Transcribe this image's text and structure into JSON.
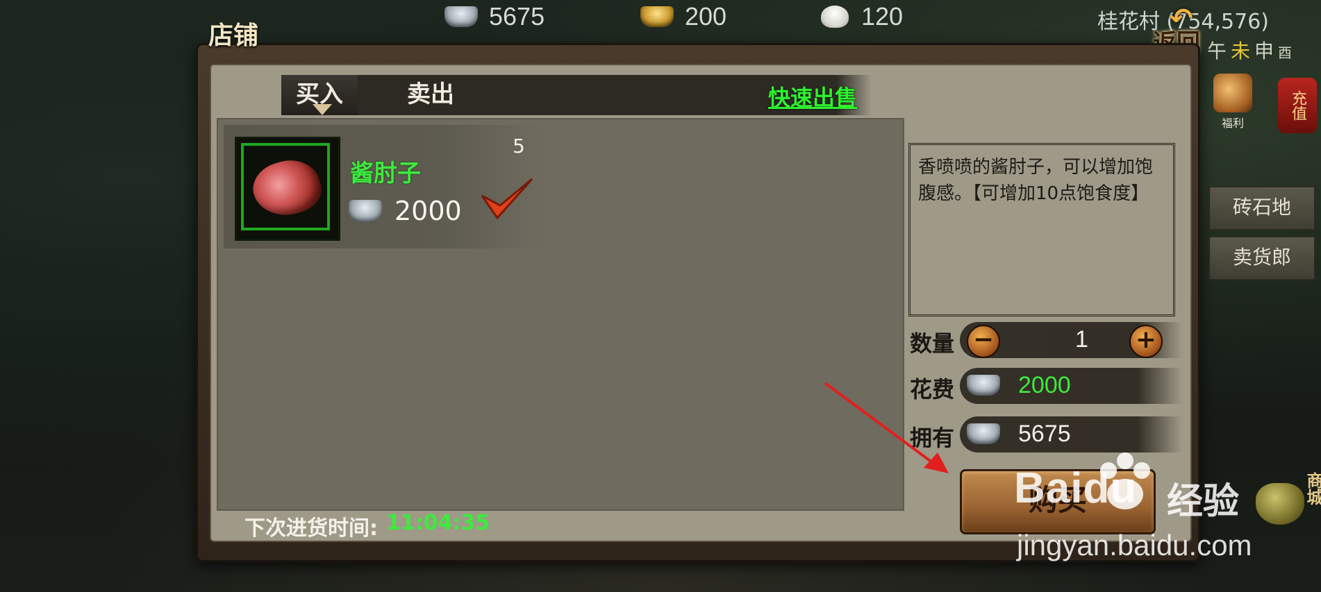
{
  "topbar": {
    "silver": "5675",
    "gold": "200",
    "buns": "120",
    "location": "桂花村 (754,576)",
    "back_label": "返回",
    "time_slots": [
      "午",
      "未",
      "申",
      "酉"
    ],
    "active_slot": "未"
  },
  "side": {
    "welfare_label": "福利",
    "recharge_label": "充值",
    "menu": [
      "砖石地",
      "卖货郎"
    ],
    "mall_label": "商城"
  },
  "shop": {
    "title": "店铺",
    "tabs": [
      "买入",
      "卖出"
    ],
    "active_tab": "买入",
    "quick_sell": "快速出售",
    "items": [
      {
        "name": "酱肘子",
        "count": "5",
        "price": "2000",
        "selected": true
      }
    ],
    "description": "香喷喷的酱肘子，可以增加饱腹感。【可增加10点饱食度】",
    "quantity_label": "数量",
    "quantity": "1",
    "cost_label": "花费",
    "cost": "2000",
    "own_label": "拥有",
    "own": "5675",
    "buy_label": "购买",
    "restock_label": "下次进货时间:",
    "restock_time": "11:04:35"
  },
  "watermark": {
    "brand": "Baidu",
    "cn": "经验",
    "url": "jingyan.baidu.com"
  },
  "colors": {
    "green_text": "#3dea3d",
    "panel_bg": "#9f9988",
    "list_bg": "#6f6b5f"
  }
}
